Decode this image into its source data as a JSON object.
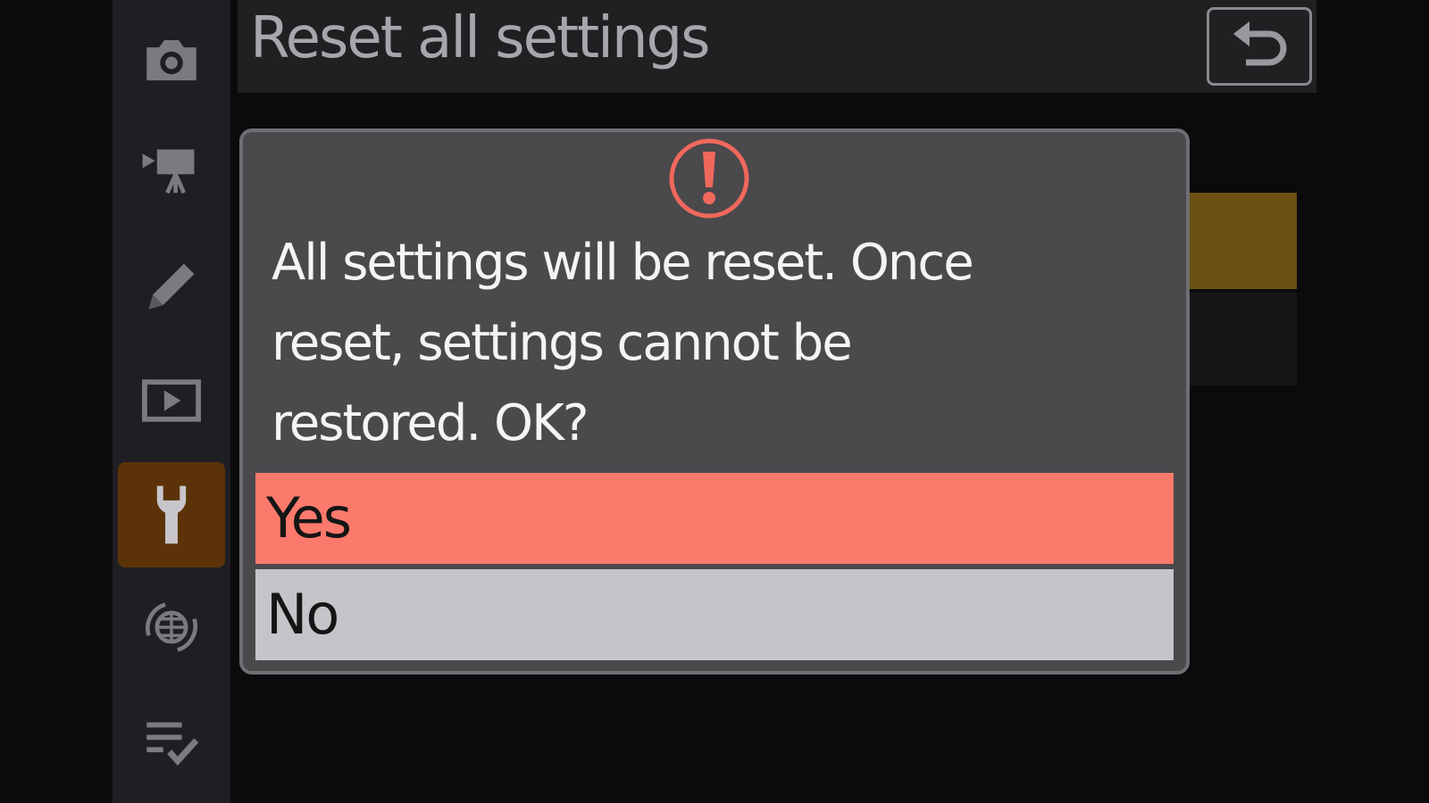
{
  "header": {
    "title": "Reset all settings",
    "back_icon": "return-arrow-icon"
  },
  "sidebar": {
    "items": [
      {
        "icon": "camera-icon",
        "active": false
      },
      {
        "icon": "movie-camera-icon",
        "active": false
      },
      {
        "icon": "pencil-icon",
        "active": false
      },
      {
        "icon": "playback-icon",
        "active": false
      },
      {
        "icon": "wrench-icon",
        "active": true
      },
      {
        "icon": "network-globe-icon",
        "active": false
      },
      {
        "icon": "my-menu-icon",
        "active": false
      }
    ]
  },
  "dialog": {
    "icon": "warning-exclamation-icon",
    "message_lines": [
      "All settings will be reset. Once",
      "reset, settings cannot be",
      "restored. OK?"
    ],
    "options": [
      {
        "label": "Yes",
        "selected": true
      },
      {
        "label": "No",
        "selected": false
      }
    ]
  },
  "colors": {
    "selected_option": "#fc7a6c",
    "unselected_option": "#c5c4c8",
    "active_tab": "#5c3308",
    "warning": "#f0685c"
  }
}
